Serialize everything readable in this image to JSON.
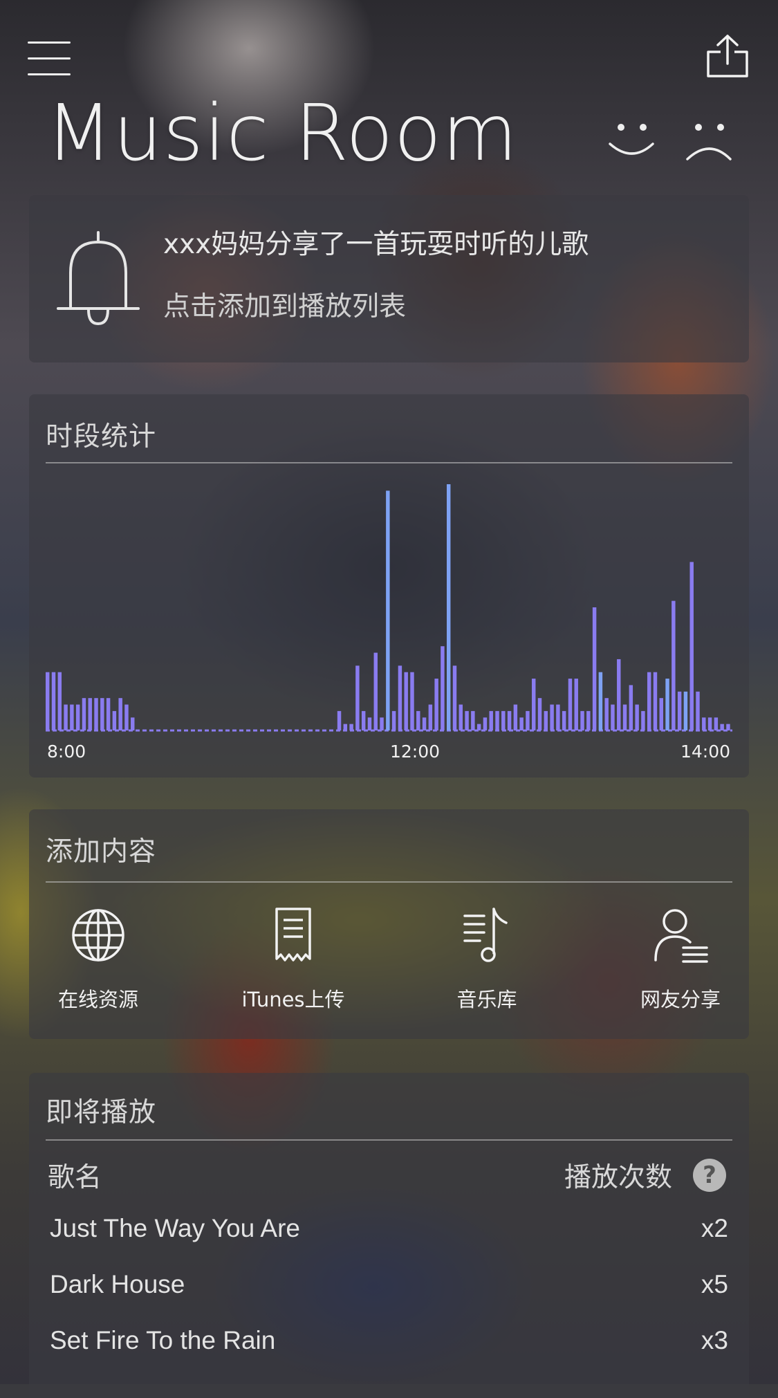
{
  "header": {
    "title": "Music Room",
    "menu_icon": "hamburger-menu-icon",
    "share_icon": "share-icon",
    "mood_icons": [
      "smile-face-icon",
      "sad-face-icon"
    ]
  },
  "notification": {
    "icon": "bell-icon",
    "message": "xxx妈妈分享了一首玩耍时听的儿歌",
    "action": "点击添加到播放列表"
  },
  "stats": {
    "title": "时段统计"
  },
  "chart_data": {
    "type": "bar",
    "x_ticks": [
      "8:00",
      "12:00",
      "14:00"
    ],
    "color": "#8a7cf0",
    "highlight_color": "#7ea2f4",
    "values": [
      9,
      9,
      9,
      4,
      4,
      4,
      5,
      5,
      5,
      5,
      5,
      3,
      5,
      4,
      2,
      0,
      0,
      0,
      0,
      0,
      0,
      0,
      0,
      0,
      0,
      0,
      0,
      0,
      0,
      0,
      0,
      0,
      0,
      0,
      0,
      0,
      0,
      0,
      0,
      0,
      0,
      0,
      0,
      0,
      0,
      0,
      0,
      0,
      3,
      1,
      1,
      10,
      3,
      2,
      12,
      2,
      37,
      3,
      10,
      9,
      9,
      3,
      2,
      4,
      8,
      13,
      38,
      10,
      4,
      3,
      3,
      1,
      2,
      3,
      3,
      3,
      3,
      4,
      2,
      3,
      8,
      5,
      3,
      4,
      4,
      3,
      8,
      8,
      3,
      3,
      19,
      9,
      5,
      4,
      11,
      4,
      7,
      4,
      3,
      9,
      9,
      5,
      8,
      20,
      6,
      6,
      26,
      6,
      2,
      2,
      2,
      1,
      1
    ],
    "highlight_indices": [
      56,
      66,
      91,
      102,
      105
    ]
  },
  "add_content": {
    "title": "添加内容",
    "items": [
      {
        "label": "在线资源",
        "icon": "globe-icon"
      },
      {
        "label": "iTunes上传",
        "icon": "receipt-icon"
      },
      {
        "label": "音乐库",
        "icon": "music-library-icon"
      },
      {
        "label": "网友分享",
        "icon": "user-list-icon"
      }
    ]
  },
  "upcoming": {
    "title": "即将播放",
    "col_song": "歌名",
    "col_plays": "播放次数",
    "help_label": "?",
    "songs": [
      {
        "name": "Just The Way You Are",
        "plays": "x2"
      },
      {
        "name": "Dark House",
        "plays": "x5"
      },
      {
        "name": "Set Fire To the Rain",
        "plays": "x3"
      }
    ]
  }
}
